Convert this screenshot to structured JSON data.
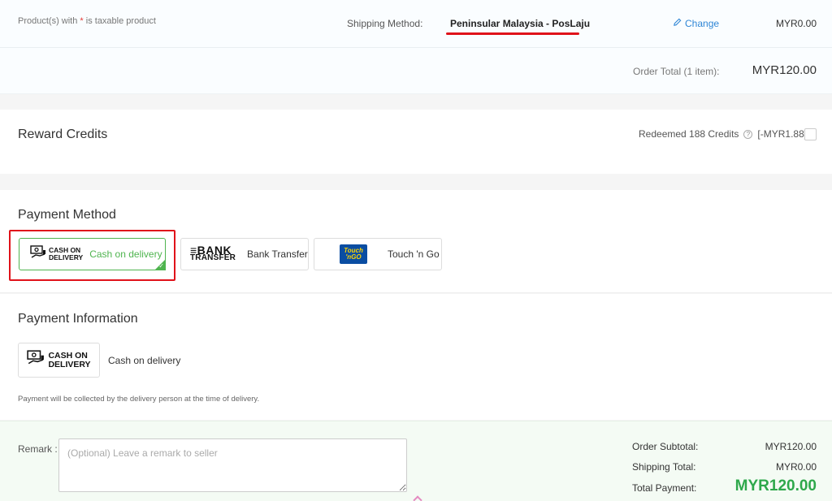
{
  "shipping": {
    "tax_note_prefix": "Product(s) with ",
    "tax_note_star": "*",
    "tax_note_suffix": " is taxable product",
    "method_label": "Shipping Method:",
    "method_value": "Peninsular Malaysia - PosLaju",
    "change_label": "Change",
    "cost": "MYR0.00",
    "order_total_label": "Order Total (1 item):",
    "order_total_value": "MYR120.00"
  },
  "reward": {
    "title": "Reward Credits",
    "redeemed_label": "Redeemed 188 Credits",
    "redeemed_value": "[-MYR1.88]",
    "checked": false
  },
  "payment_method": {
    "title": "Payment Method",
    "options": [
      {
        "logo_line1": "CASH ON",
        "logo_line2": "DELIVERY",
        "label": "Cash on delivery",
        "selected": true
      },
      {
        "logo_line1": "≡BANK",
        "logo_line2": "TRANSFER",
        "label": "Bank Transfer",
        "selected": false
      },
      {
        "logo_line1": "Touch",
        "logo_line2": "'nGO",
        "label": "Touch 'n Go",
        "selected": false
      }
    ]
  },
  "payment_info": {
    "title": "Payment Information",
    "logo_line1": "CASH ON",
    "logo_line2": "DELIVERY",
    "name": "Cash on delivery",
    "description": "Payment will be collected by the delivery person at the time of delivery."
  },
  "summary": {
    "remark_label": "Remark",
    "remark_placeholder": "(Optional) Leave a remark to seller",
    "subtotal_label": "Order Subtotal:",
    "subtotal_value": "MYR120.00",
    "shipping_label": "Shipping Total:",
    "shipping_value": "MYR0.00",
    "total_label": "Total Payment:",
    "total_value": "MYR120.00"
  },
  "colors": {
    "accent_green": "#2ea84b",
    "link_blue": "#2f86d6",
    "highlight_red": "#e0121a"
  }
}
